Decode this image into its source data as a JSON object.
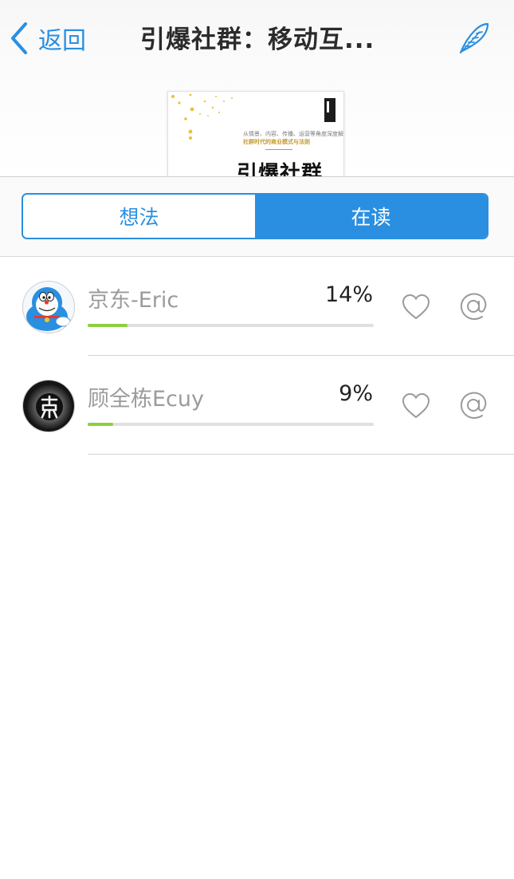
{
  "nav": {
    "back_label": "返回",
    "title": "引爆社群：移动互...",
    "compose_icon": "feather-icon"
  },
  "book_cover": {
    "line1": "从情景、内容、传播、运营等角度深度解构",
    "line2": "社群时代的商业模式与法则",
    "title": "引爆社群"
  },
  "tabs": [
    {
      "label": "想法",
      "active": false
    },
    {
      "label": "在读",
      "active": true
    }
  ],
  "readers": [
    {
      "name": "京东-Eric",
      "percent": "14%",
      "progress": 0.14,
      "avatar": "doraemon-avatar"
    },
    {
      "name": "顾全栋Ecuy",
      "percent": "9%",
      "progress": 0.09,
      "avatar": "dark-logo-avatar"
    }
  ],
  "colors": {
    "accent": "#2a8fe0",
    "progress": "#8ccf3f",
    "divider": "#d4d4d4",
    "muted_text": "#9b9b9b"
  }
}
